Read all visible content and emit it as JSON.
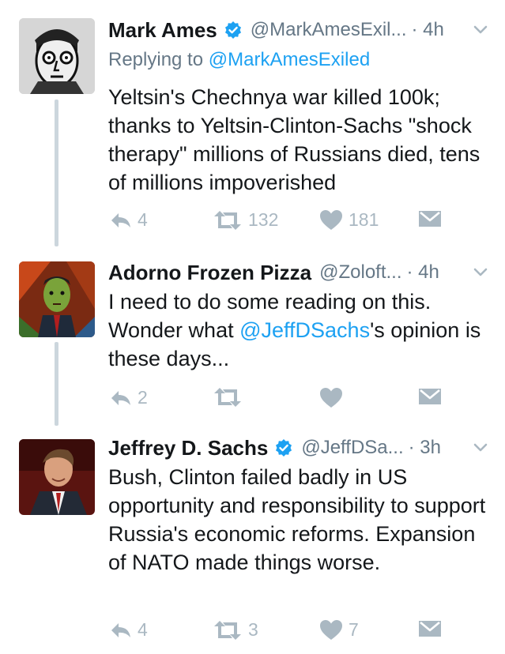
{
  "tweets": [
    {
      "name": "Mark Ames",
      "verified": true,
      "handle": "@MarkAmesExil...",
      "time": "· 4h",
      "replying_label": "Replying to",
      "replying_handle": "@MarkAmesExiled",
      "text": "Yeltsin's Chechnya war killed 100k; thanks to Yeltsin-Clinton-Sachs \"shock therapy\" millions of Russians died, tens of millions impoverished",
      "replies": "4",
      "retweets": "132",
      "likes": "181"
    },
    {
      "name": "Adorno Frozen Pizza",
      "verified": false,
      "handle": "@Zoloft...",
      "time": "· 4h",
      "text_before": "I need to do some reading on this. Wonder what ",
      "mention": "@JeffDSachs",
      "text_after": "'s opinion is these days...",
      "replies": "2",
      "retweets": "",
      "likes": ""
    },
    {
      "name": "Jeffrey D. Sachs",
      "verified": true,
      "handle": "@JeffDSa...",
      "time": "· 3h",
      "text": "Bush, Clinton failed badly in US opportunity and responsibility to support Russia's economic reforms. Expansion of NATO made things worse.",
      "replies": "4",
      "retweets": "3",
      "likes": "7"
    }
  ],
  "colors": {
    "link": "#1da1f2",
    "muted": "#657786",
    "icon": "#aab8c2",
    "thread_line": "#ccd6dd"
  },
  "icons": [
    "verified-badge-icon",
    "chevron-down-icon",
    "reply-icon",
    "retweet-icon",
    "heart-icon",
    "direct-message-icon"
  ]
}
